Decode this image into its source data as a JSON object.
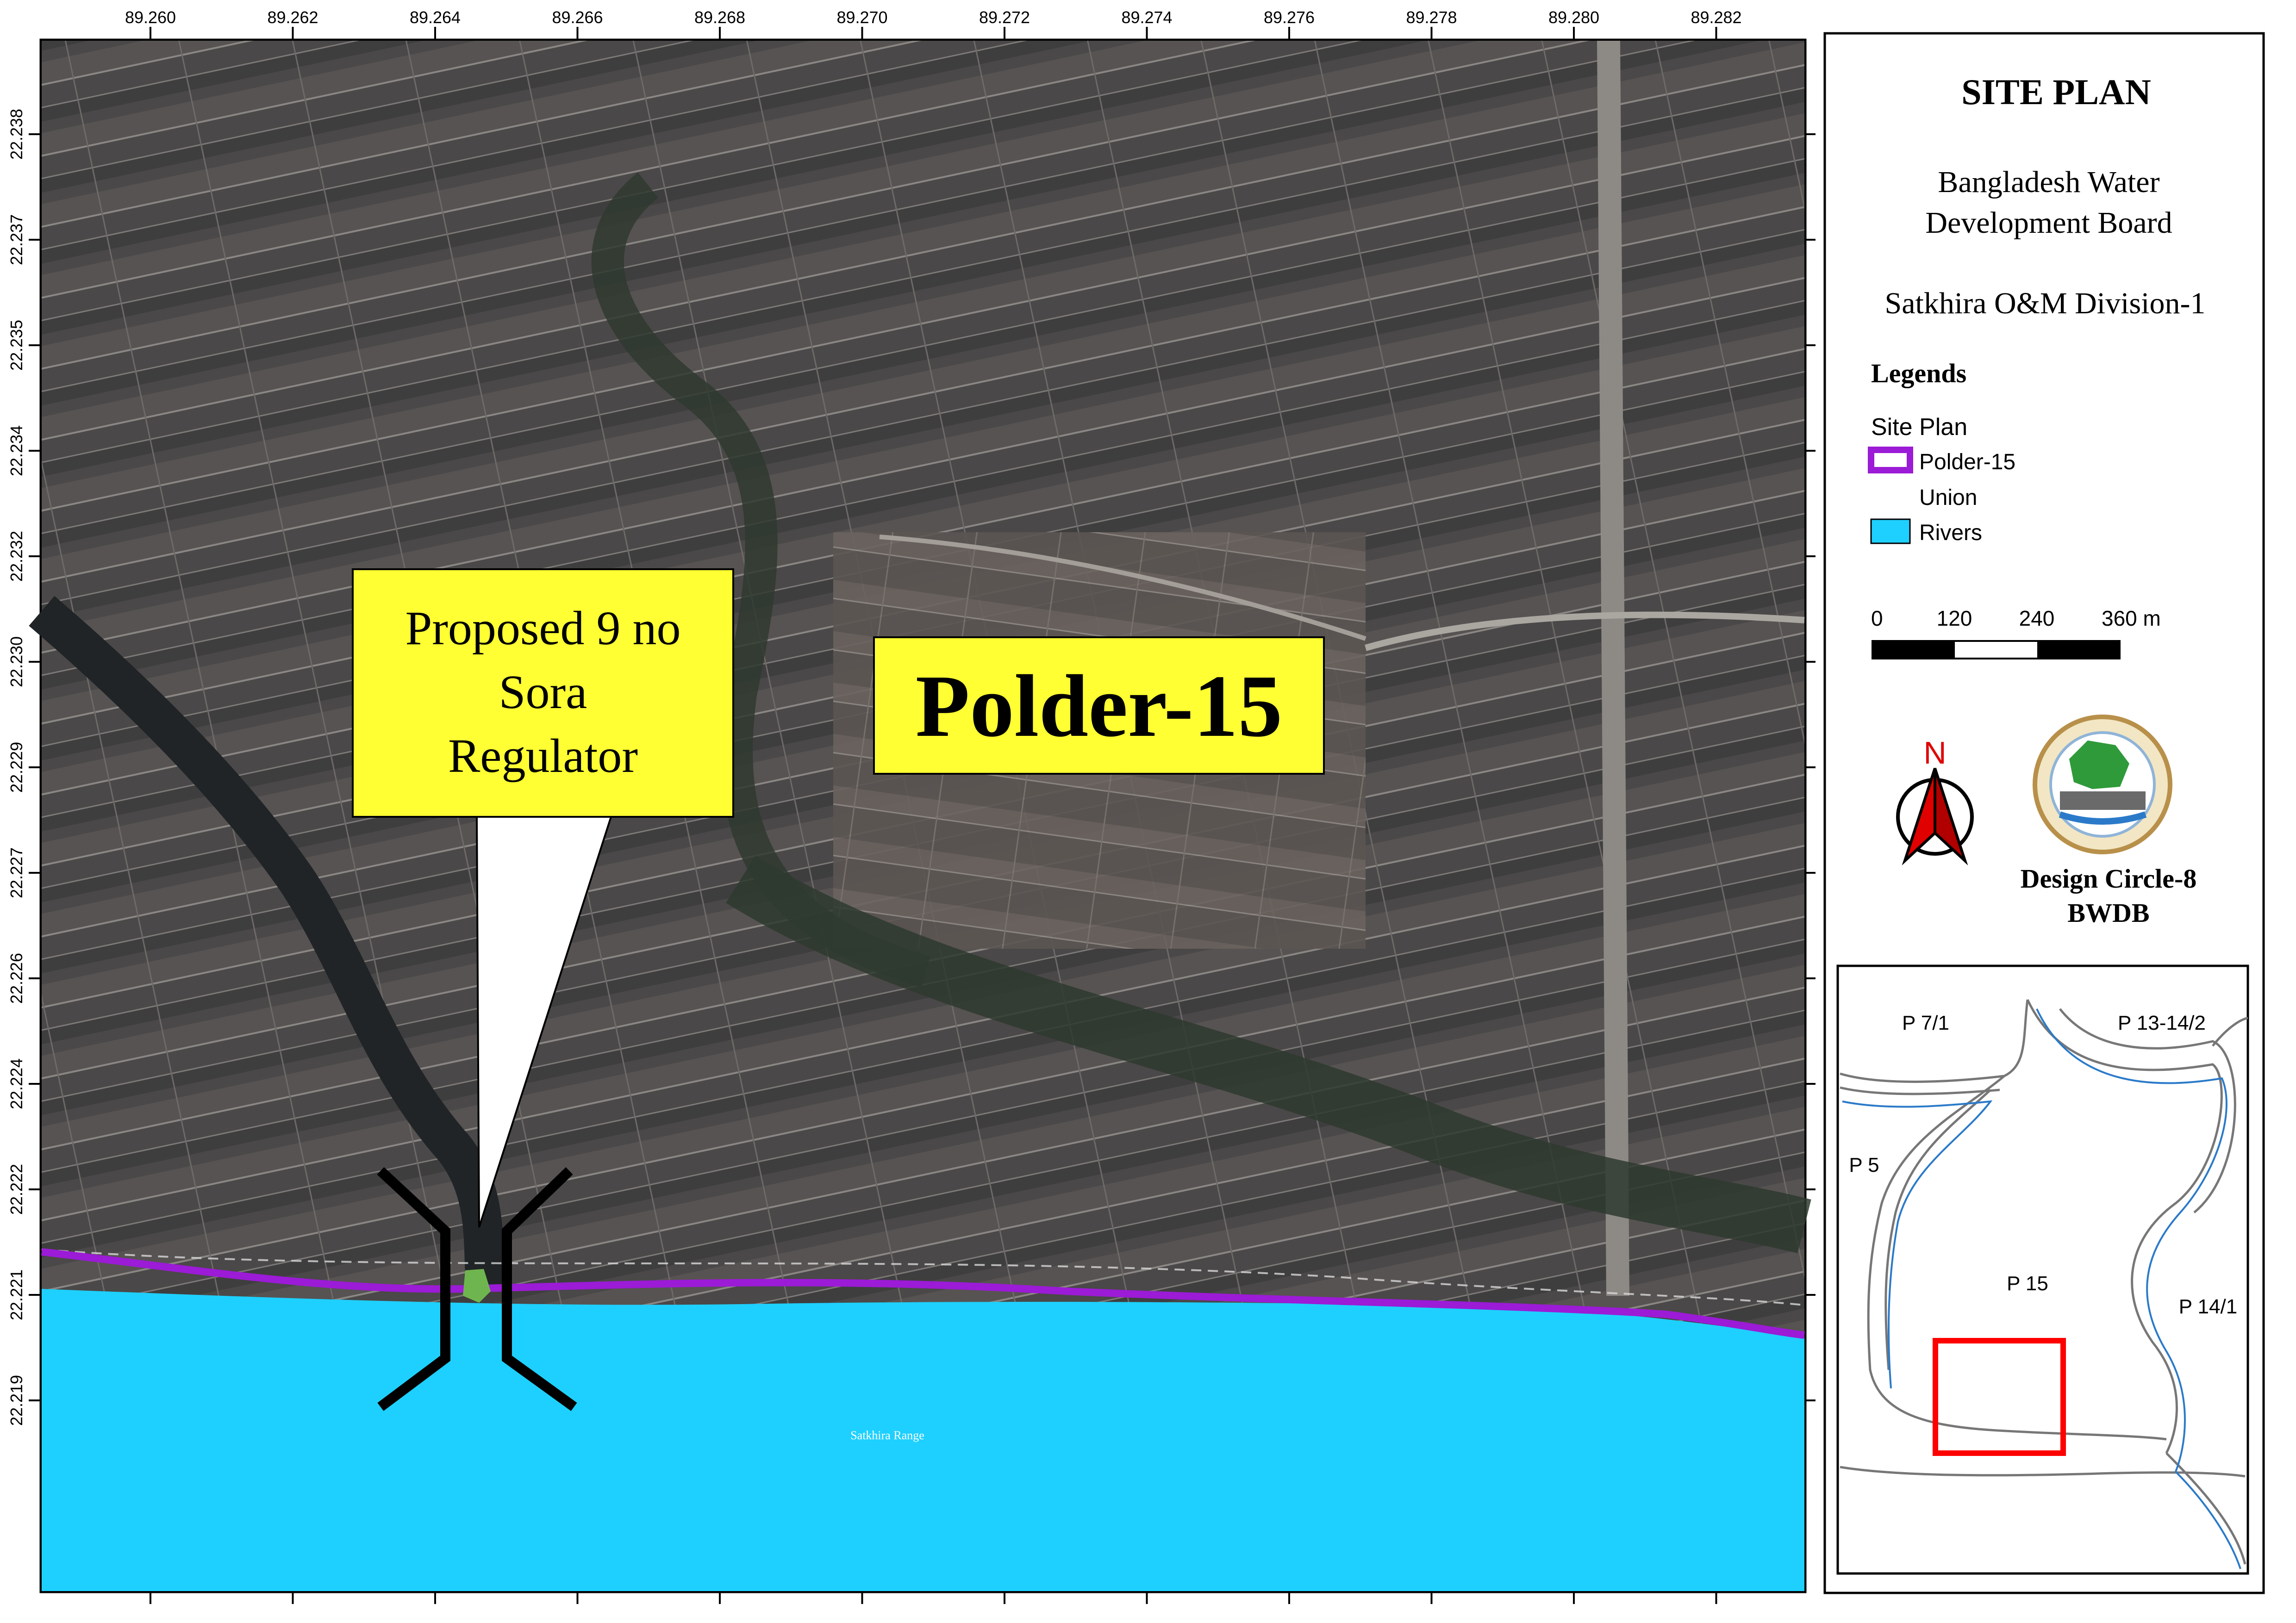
{
  "map": {
    "top_ticks": [
      "89.260",
      "89.262",
      "89.264",
      "89.266",
      "89.268",
      "89.270",
      "89.272",
      "89.274",
      "89.276",
      "89.278",
      "89.280",
      "89.282"
    ],
    "left_ticks": [
      "22.238",
      "22.237",
      "22.235",
      "22.234",
      "22.232",
      "22.230",
      "22.229",
      "22.227",
      "22.226",
      "22.224",
      "22.222",
      "22.221",
      "22.219"
    ],
    "callout_line1": "Proposed 9 no",
    "callout_line2": "Sora",
    "callout_line3": "Regulator",
    "polder_label": "Polder-15",
    "river_label": "Satkhira Range",
    "colors": {
      "polder": "#9b1bd6",
      "river": "#1ed0ff",
      "callout": "#ffff33"
    }
  },
  "panel": {
    "title": "SITE PLAN",
    "org_line1": "Bangladesh Water",
    "org_line2": "Development Board",
    "division": "Satkhira O&M Division-1",
    "legends_title": "Legends",
    "legend_group": "Site Plan",
    "legend_items": [
      "Polder-15",
      "Union",
      "Rivers"
    ],
    "scale_labels": [
      "0",
      "120",
      "240",
      "360 m"
    ],
    "north_label": "N",
    "credit_line1": "Design Circle-8",
    "credit_line2": "BWDB"
  },
  "inset": {
    "labels": [
      "P 7/1",
      "P 13-14/2",
      "P 5",
      "P 15",
      "P 14/1"
    ]
  }
}
